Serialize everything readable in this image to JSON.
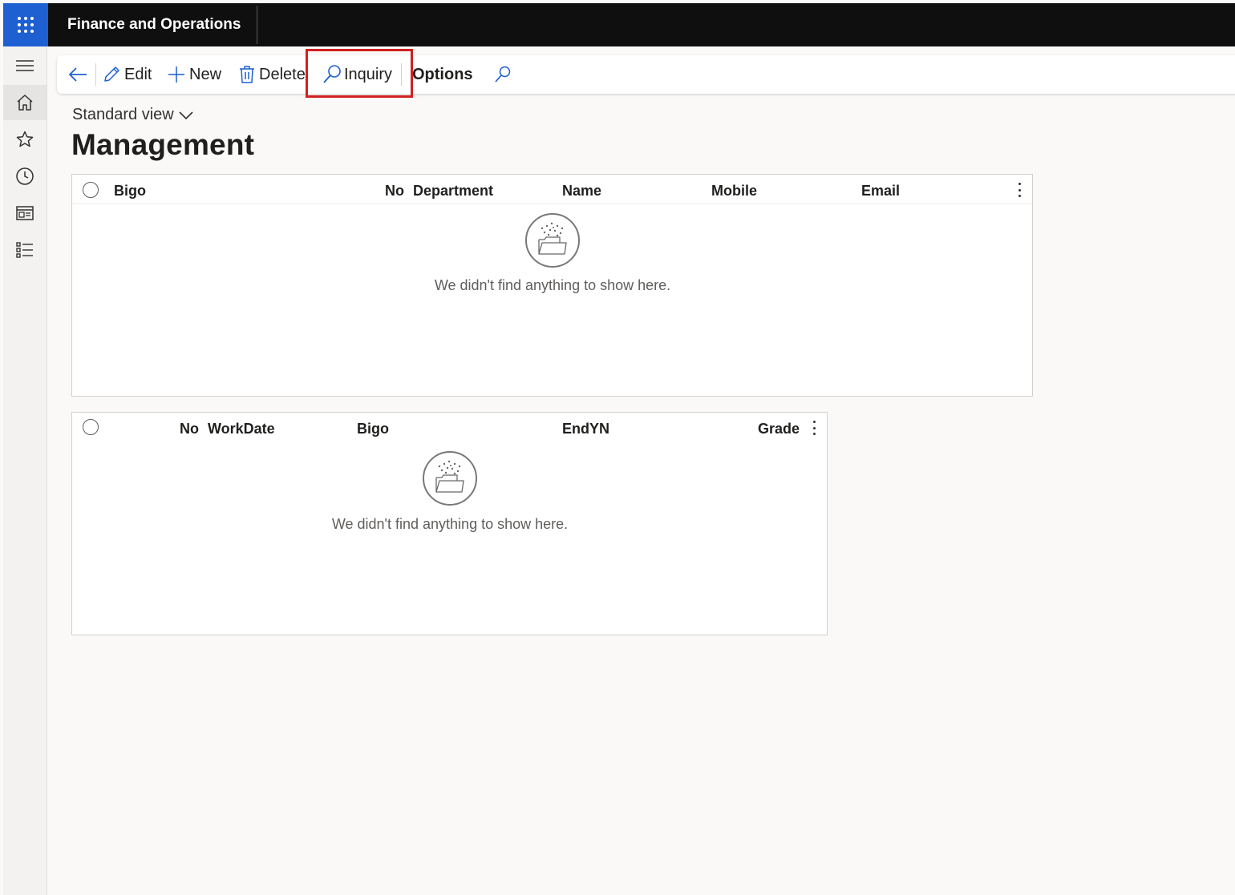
{
  "app": {
    "title": "Finance and Operations"
  },
  "nav": {
    "items": [
      {
        "icon": "hamburger-icon"
      },
      {
        "icon": "home-icon"
      },
      {
        "icon": "star-icon"
      },
      {
        "icon": "clock-icon"
      },
      {
        "icon": "workspace-icon"
      },
      {
        "icon": "modules-list-icon"
      }
    ]
  },
  "action_pane": {
    "edit": "Edit",
    "new": "New",
    "delete": "Delete",
    "inquiry": "Inquiry",
    "options": "Options"
  },
  "view": {
    "label": "Standard view"
  },
  "page": {
    "title": "Management"
  },
  "grid1": {
    "columns": [
      "Bigo",
      "No",
      "Department",
      "Name",
      "Mobile",
      "Email"
    ],
    "empty_message": "We didn't find anything to show here."
  },
  "grid2": {
    "columns": [
      "No",
      "WorkDate",
      "Bigo",
      "EndYN",
      "Grade"
    ],
    "empty_message": "We didn't find anything to show here."
  },
  "colors": {
    "accent": "#1e5fd1",
    "topbar": "#0f0f0f",
    "highlight": "#d32020"
  }
}
